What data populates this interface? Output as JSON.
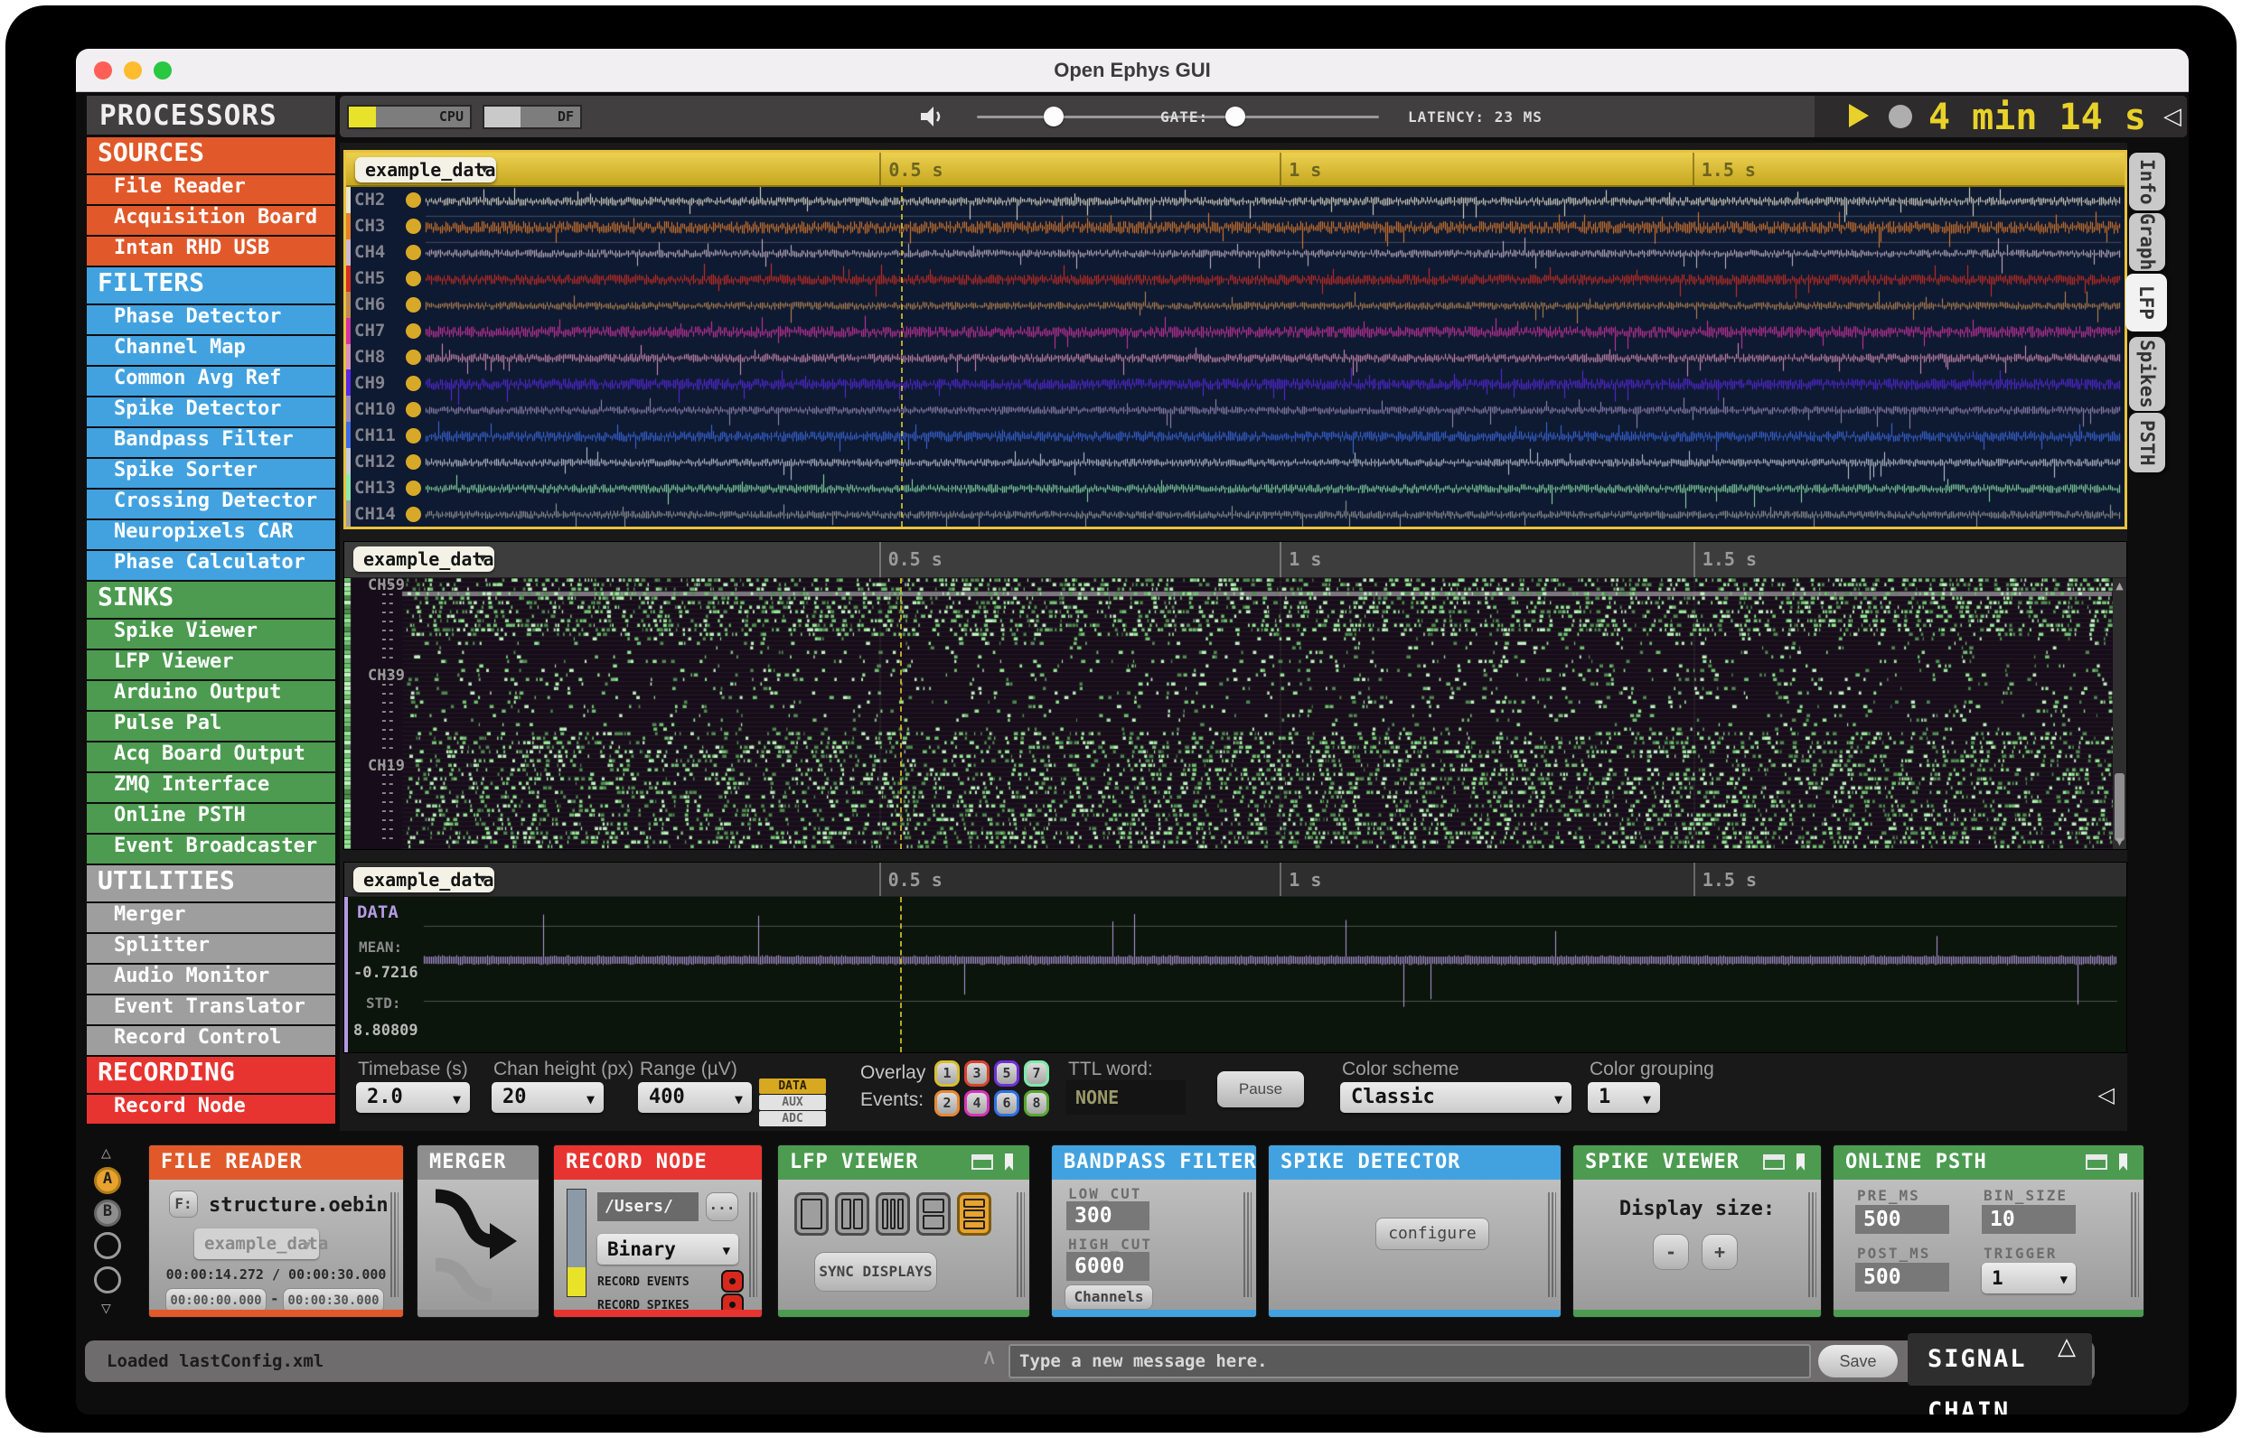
{
  "window": {
    "title": "Open Ephys GUI"
  },
  "toolbar": {
    "cpu_label": "CPU",
    "df_label": "DF",
    "gate_label": "GATE:",
    "latency_text": "LATENCY: 23 MS",
    "clock_text": "4 min 14 s",
    "collapse_glyph": "◁"
  },
  "right_tabs": [
    {
      "label": "Info",
      "active": false
    },
    {
      "label": "Graph",
      "active": false
    },
    {
      "label": "LFP",
      "active": true
    },
    {
      "label": "Spikes",
      "active": false
    },
    {
      "label": "PSTH",
      "active": false
    }
  ],
  "sidebar": {
    "title": "PROCESSORS",
    "sections": [
      {
        "name": "SOURCES",
        "color": "#E1592A",
        "items": [
          "File Reader",
          "Acquisition Board",
          "Intan RHD USB"
        ]
      },
      {
        "name": "FILTERS",
        "color": "#42A2E0",
        "items": [
          "Phase Detector",
          "Channel Map",
          "Common Avg Ref",
          "Spike Detector",
          "Bandpass Filter",
          "Spike Sorter",
          "Crossing Detector",
          "Neuropixels CAR",
          "Phase Calculator"
        ]
      },
      {
        "name": "SINKS",
        "color": "#4C9B50",
        "items": [
          "Spike Viewer",
          "LFP Viewer",
          "Arduino Output",
          "Pulse Pal",
          "Acq Board Output",
          "ZMQ Interface",
          "Online PSTH",
          "Event Broadcaster"
        ]
      },
      {
        "name": "UTILITIES",
        "color": "#9E9E9E",
        "items": [
          "Merger",
          "Splitter",
          "Audio Monitor",
          "Event Translator",
          "Record Control"
        ]
      },
      {
        "name": "RECORDING",
        "color": "#E83430",
        "items": [
          "Record Node"
        ]
      }
    ]
  },
  "panels": {
    "time_ticks": [
      {
        "label": "0.5 s",
        "pos": 0.3
      },
      {
        "label": "1 s",
        "pos": 0.525
      },
      {
        "label": "1.5 s",
        "pos": 0.757
      }
    ],
    "playhead_pos": 0.312,
    "lfp": {
      "source_label": "example_data",
      "channels": [
        {
          "label": "CH2",
          "color": "#E9E4CF"
        },
        {
          "label": "CH3",
          "color": "#E87F2B"
        },
        {
          "label": "CH4",
          "color": "#CDBACD"
        },
        {
          "label": "CH5",
          "color": "#D92F22"
        },
        {
          "label": "CH6",
          "color": "#C28A52"
        },
        {
          "label": "CH7",
          "color": "#D632A5"
        },
        {
          "label": "CH8",
          "color": "#DD92BB"
        },
        {
          "label": "CH9",
          "color": "#5A28E8"
        },
        {
          "label": "CH10",
          "color": "#9D8DBE"
        },
        {
          "label": "CH11",
          "color": "#3D6CE8"
        },
        {
          "label": "CH12",
          "color": "#C6CDDB"
        },
        {
          "label": "CH13",
          "color": "#8FE9AC"
        },
        {
          "label": "CH14",
          "color": "#9E9E9E"
        }
      ]
    },
    "raster": {
      "source_label": "example_data",
      "row_labels": [
        "CH59",
        "CH39",
        "CH19"
      ],
      "dash_label": "--"
    },
    "data": {
      "source_label": "example_data",
      "title_label": "DATA",
      "mean_label": "MEAN:",
      "mean_value": "-0.7216",
      "std_label": "STD:",
      "std_value": "8.80809",
      "trace_color": "#B59BE3"
    }
  },
  "controls": {
    "timebase_label": "Timebase (s)",
    "timebase_value": "2.0",
    "chan_height_label": "Chan height (px)",
    "chan_height_value": "20",
    "range_label": "Range (µV)",
    "range_value": "400",
    "stream_buttons": [
      {
        "label": "DATA",
        "active": true
      },
      {
        "label": "AUX",
        "active": false
      },
      {
        "label": "ADC",
        "active": false
      }
    ],
    "overlay_line1": "Overlay",
    "overlay_line2": "Events:",
    "event_rows": [
      [
        {
          "n": "1",
          "color": "#D8BE2C"
        },
        {
          "n": "3",
          "color": "#D8432C"
        },
        {
          "n": "5",
          "color": "#7130D8"
        },
        {
          "n": "7",
          "color": "#7FE9A9"
        }
      ],
      [
        {
          "n": "2",
          "color": "#E8872F"
        },
        {
          "n": "4",
          "color": "#D832B8"
        },
        {
          "n": "6",
          "color": "#2F6FE8"
        },
        {
          "n": "8",
          "color": "#58A82E"
        }
      ]
    ],
    "ttl_label": "TTL word:",
    "ttl_value": "NONE",
    "pause_label": "Pause",
    "color_scheme_label": "Color scheme",
    "color_scheme_value": "Classic",
    "color_grouping_label": "Color grouping",
    "color_grouping_value": "1"
  },
  "chain": {
    "slot_a_label": "A",
    "slot_b_label": "B",
    "processors": {
      "file_reader": {
        "title": "FILE READER",
        "color": "#E1592A",
        "file_button_label": "F:",
        "filename": "structure.oebin",
        "stream_value": "example_data",
        "progress_text": "00:00:14.272 / 00:00:30.000",
        "start_time": "00:00:00.000",
        "range_separator": "-",
        "end_time": "00:00:30.000"
      },
      "merger": {
        "title": "MERGER",
        "color": "#8E8E8E"
      },
      "record_node": {
        "title": "RECORD NODE",
        "color": "#E83430",
        "path_value": "/Users/",
        "browse_label": "...",
        "format_value": "Binary",
        "record_events_label": "RECORD EVENTS",
        "record_spikes_label": "RECORD SPIKES"
      },
      "lfp_viewer": {
        "title": "LFP VIEWER",
        "color": "#4C9B50",
        "sync_label": "SYNC DISPLAYS"
      },
      "bandpass_filter": {
        "title": "BANDPASS FILTER",
        "color": "#42A2E0",
        "low_cut_label": "LOW_CUT",
        "low_cut_value": "300",
        "high_cut_label": "HIGH_CUT",
        "high_cut_value": "6000",
        "channels_label": "Channels"
      },
      "spike_detector": {
        "title": "SPIKE DETECTOR",
        "color": "#42A2E0",
        "configure_label": "configure"
      },
      "spike_viewer": {
        "title": "SPIKE VIEWER",
        "color": "#4C9B50",
        "display_size_label": "Display size:",
        "minus_label": "-",
        "plus_label": "+"
      },
      "online_psth": {
        "title": "ONLINE PSTH",
        "color": "#4C9B50",
        "pre_ms_label": "PRE_MS",
        "pre_ms_value": "500",
        "bin_size_label": "BIN_SIZE",
        "bin_size_value": "10",
        "post_ms_label": "POST_MS",
        "post_ms_value": "500",
        "trigger_label": "TRIGGER",
        "trigger_value": "1"
      }
    }
  },
  "status": {
    "message": "Loaded lastConfig.xml",
    "input_placeholder": "Type a new message here.",
    "save_label": "Save",
    "signal_chain_label": "SIGNAL CHAIN",
    "signal_chain_glyph": "△"
  }
}
